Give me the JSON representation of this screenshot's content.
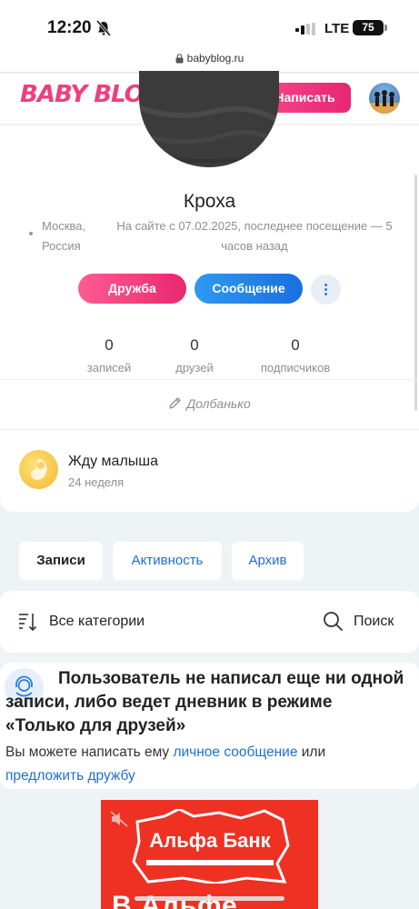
{
  "status_bar": {
    "time": "12:20",
    "network": "LTE",
    "battery": "75"
  },
  "browser": {
    "url": "babyblog.ru"
  },
  "header": {
    "logo": "BABY BLOG",
    "write_button": "Написать"
  },
  "profile": {
    "name": "Кроха",
    "location": "Москва, Россия",
    "since": "На сайте с 07.02.2025, последнее посещение — 5 часов назад",
    "friend_button": "Дружба",
    "message_button": "Сообщение",
    "stats": [
      {
        "value": "0",
        "label": "записей"
      },
      {
        "value": "0",
        "label": "друзей"
      },
      {
        "value": "0",
        "label": "подписчиков"
      }
    ],
    "status": "Долбанько",
    "pregnancy": {
      "title": "Жду малыша",
      "week": "24 неделя"
    }
  },
  "tabs": [
    {
      "label": "Записи",
      "active": true
    },
    {
      "label": "Активность",
      "active": false
    },
    {
      "label": "Архив",
      "active": false
    }
  ],
  "filter": {
    "categories": "Все категории",
    "search": "Поиск"
  },
  "notice": {
    "title": "Пользователь не написал еще ни одной записи, либо ведет дневник в режиме «Только для друзей»",
    "text_before": "Вы можете написать ему ",
    "link_message": "личное сообщение",
    "text_middle": " или ",
    "link_friend": "предложить дружбу"
  },
  "ad": {
    "brand": "Альфа Банк",
    "bottom_text": "В Альфе"
  },
  "colors": {
    "accent_pink": "#e8276f",
    "accent_blue": "#1f6fd1",
    "ad_red": "#ef3124"
  }
}
